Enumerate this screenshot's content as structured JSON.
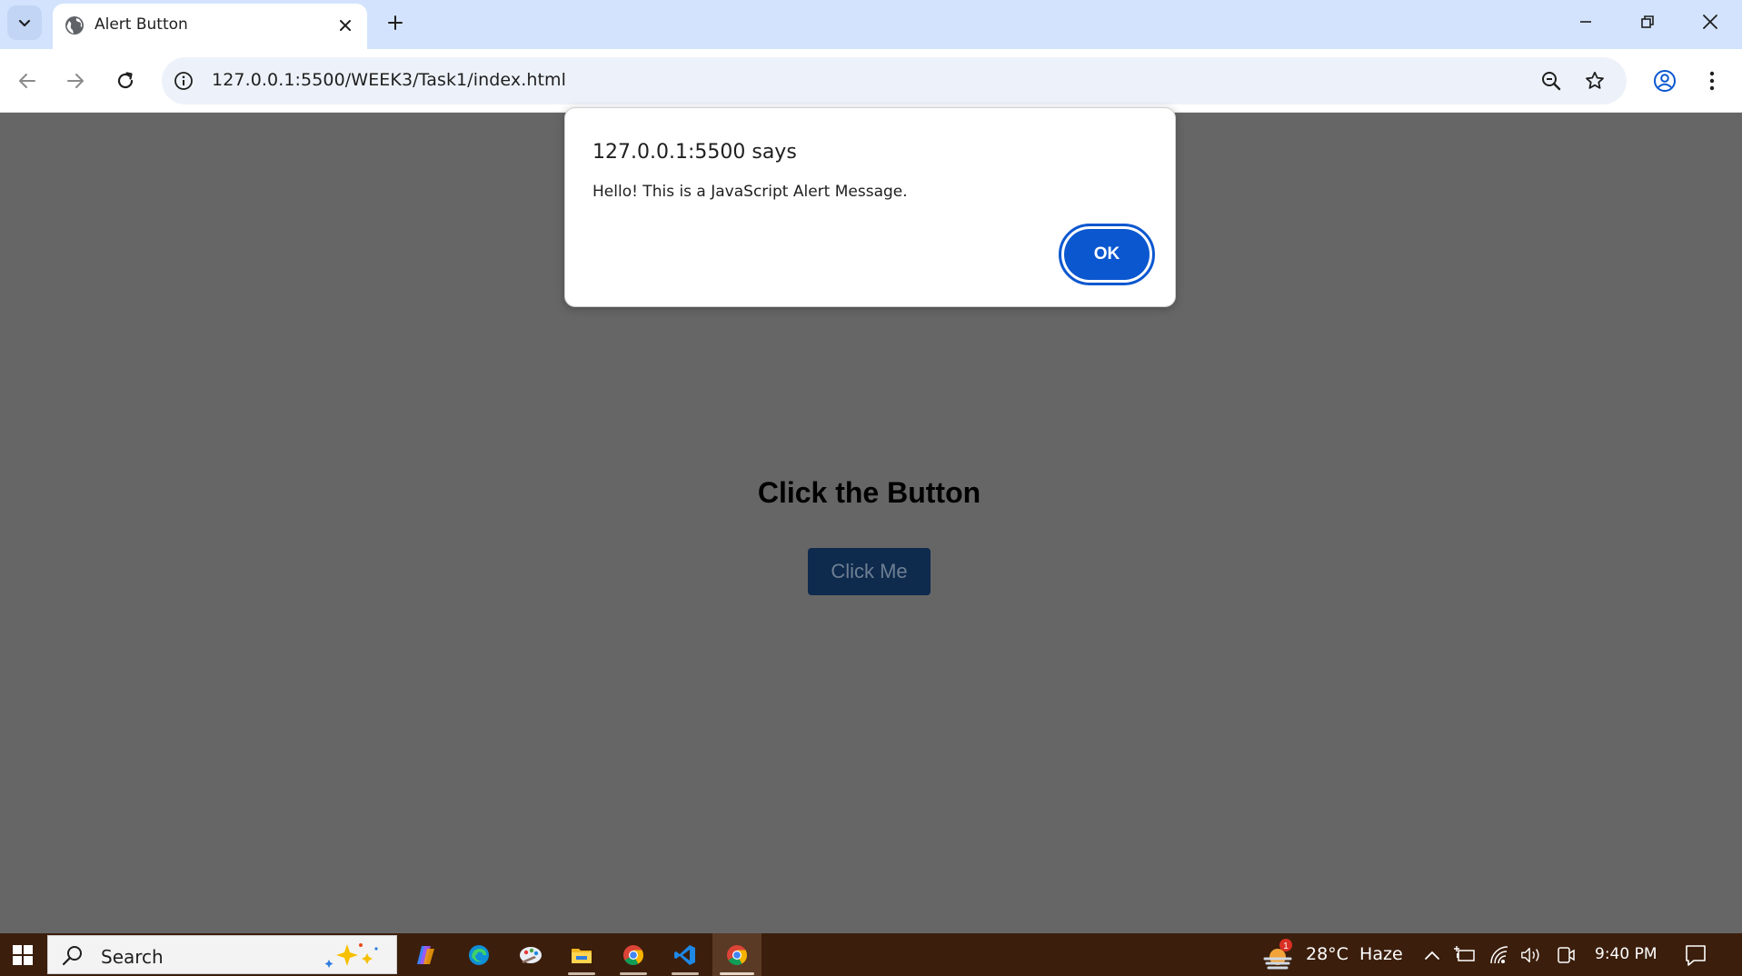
{
  "browser": {
    "tab": {
      "title": "Alert Button"
    },
    "address_bar": {
      "url": "127.0.0.1:5500/WEEK3/Task1/index.html"
    }
  },
  "page": {
    "heading": "Click the Button",
    "button_label": "Click Me"
  },
  "alert_dialog": {
    "title": "127.0.0.1:5500 says",
    "message": "Hello! This is a JavaScript Alert Message.",
    "ok_label": "OK"
  },
  "taskbar": {
    "search_placeholder": "Search",
    "apps": [
      "copilot-icon",
      "edge-icon",
      "paint-icon",
      "file-explorer-icon",
      "chrome-icon",
      "vscode-icon",
      "chrome-icon"
    ],
    "weather": {
      "temp": "28°C",
      "condition": "Haze",
      "badge": "1"
    },
    "clock": "9:40 PM"
  },
  "colors": {
    "tabstrip_bg": "#d3e3fd",
    "dim_overlay": "#666666",
    "dialog_accent": "#0b57d0",
    "taskbar_bg": "#3b1e0c"
  }
}
